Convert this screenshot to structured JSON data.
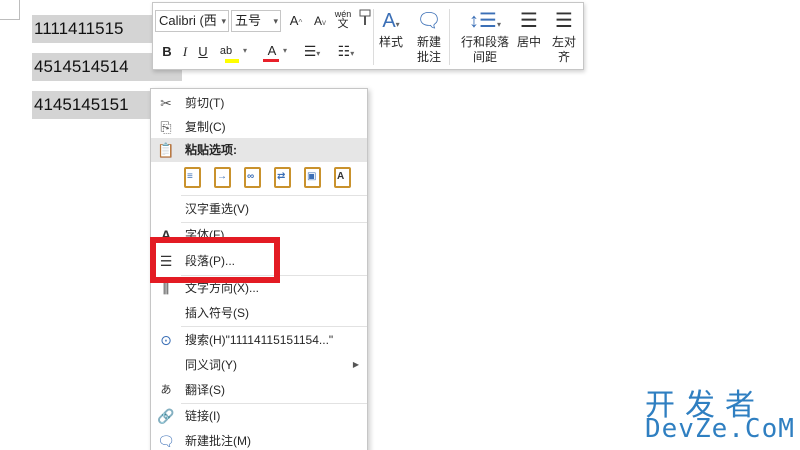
{
  "document": {
    "lines": [
      "1111411515",
      "4514514514",
      "4145145151"
    ]
  },
  "mini_toolbar": {
    "font_name": "Calibri (西",
    "font_size": "五号",
    "grow_font": "A",
    "shrink_font": "A",
    "phonetic_top": "wén",
    "phonetic_bottom": "文",
    "bold": "B",
    "italic": "I",
    "underline": "U",
    "highlight_glyph": "ab",
    "font_color_glyph": "A",
    "styles_label": "样式",
    "new_comment_label_1": "新建",
    "new_comment_label_2": "批注",
    "line_spacing_label_1": "行和段落",
    "line_spacing_label_2": "间距",
    "center_label": "居中",
    "align_left_label_1": "左对",
    "align_left_label_2": "齐",
    "highlight_color": "#ffff00",
    "font_color": "#e8202a"
  },
  "context_menu": {
    "cut": "剪切(T)",
    "copy": "复制(C)",
    "paste_options": "粘贴选项:",
    "reselect_chinese": "汉字重选(V)",
    "font": "字体(F)...",
    "paragraph": "段落(P)...",
    "text_direction": "文字方向(X)...",
    "insert_symbol": "插入符号(S)",
    "search": "搜索(H)\"11114115151154...\"",
    "synonyms": "同义词(Y)",
    "translate": "翻译(S)",
    "link": "链接(I)",
    "new_comment": "新建批注(M)"
  },
  "highlight_color": "#e31b23",
  "watermark": {
    "cn": "开发者",
    "en": "DevZe.CoM"
  }
}
